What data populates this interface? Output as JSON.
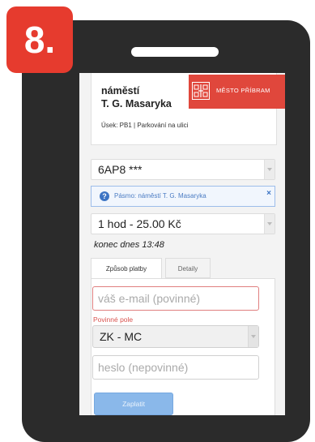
{
  "step_badge": "8.",
  "zone": {
    "name_line1": "náměstí",
    "name_line2": "T. G. Masaryka",
    "city_logo_text": "MĚSTO PŘÍBRAM",
    "section": "Úsek: PB1 | Parkování na ulici"
  },
  "plate_select": {
    "value": "6AP8 ***"
  },
  "zone_alert": {
    "text": "Pásmo: náměstí T. G. Masaryka",
    "close": "×"
  },
  "duration_select": {
    "value": "1 hod - 25.00 Kč"
  },
  "end_time": "konec dnes 13:48",
  "tabs": [
    {
      "label": "Způsob platby"
    },
    {
      "label": "Detaily"
    }
  ],
  "form": {
    "email_placeholder": "váš e-mail (povinné)",
    "required_label": "Povinné pole",
    "operator_select": "ZK - MC",
    "password_placeholder": "heslo (nepovinné)",
    "pay_button": "Zaplatit"
  },
  "colors": {
    "badge": "#e63b2e",
    "city_logo": "#e0473c",
    "info_blue": "#3c74c4",
    "error_red": "#d9534f",
    "pay_button": "#8ab8ea"
  }
}
